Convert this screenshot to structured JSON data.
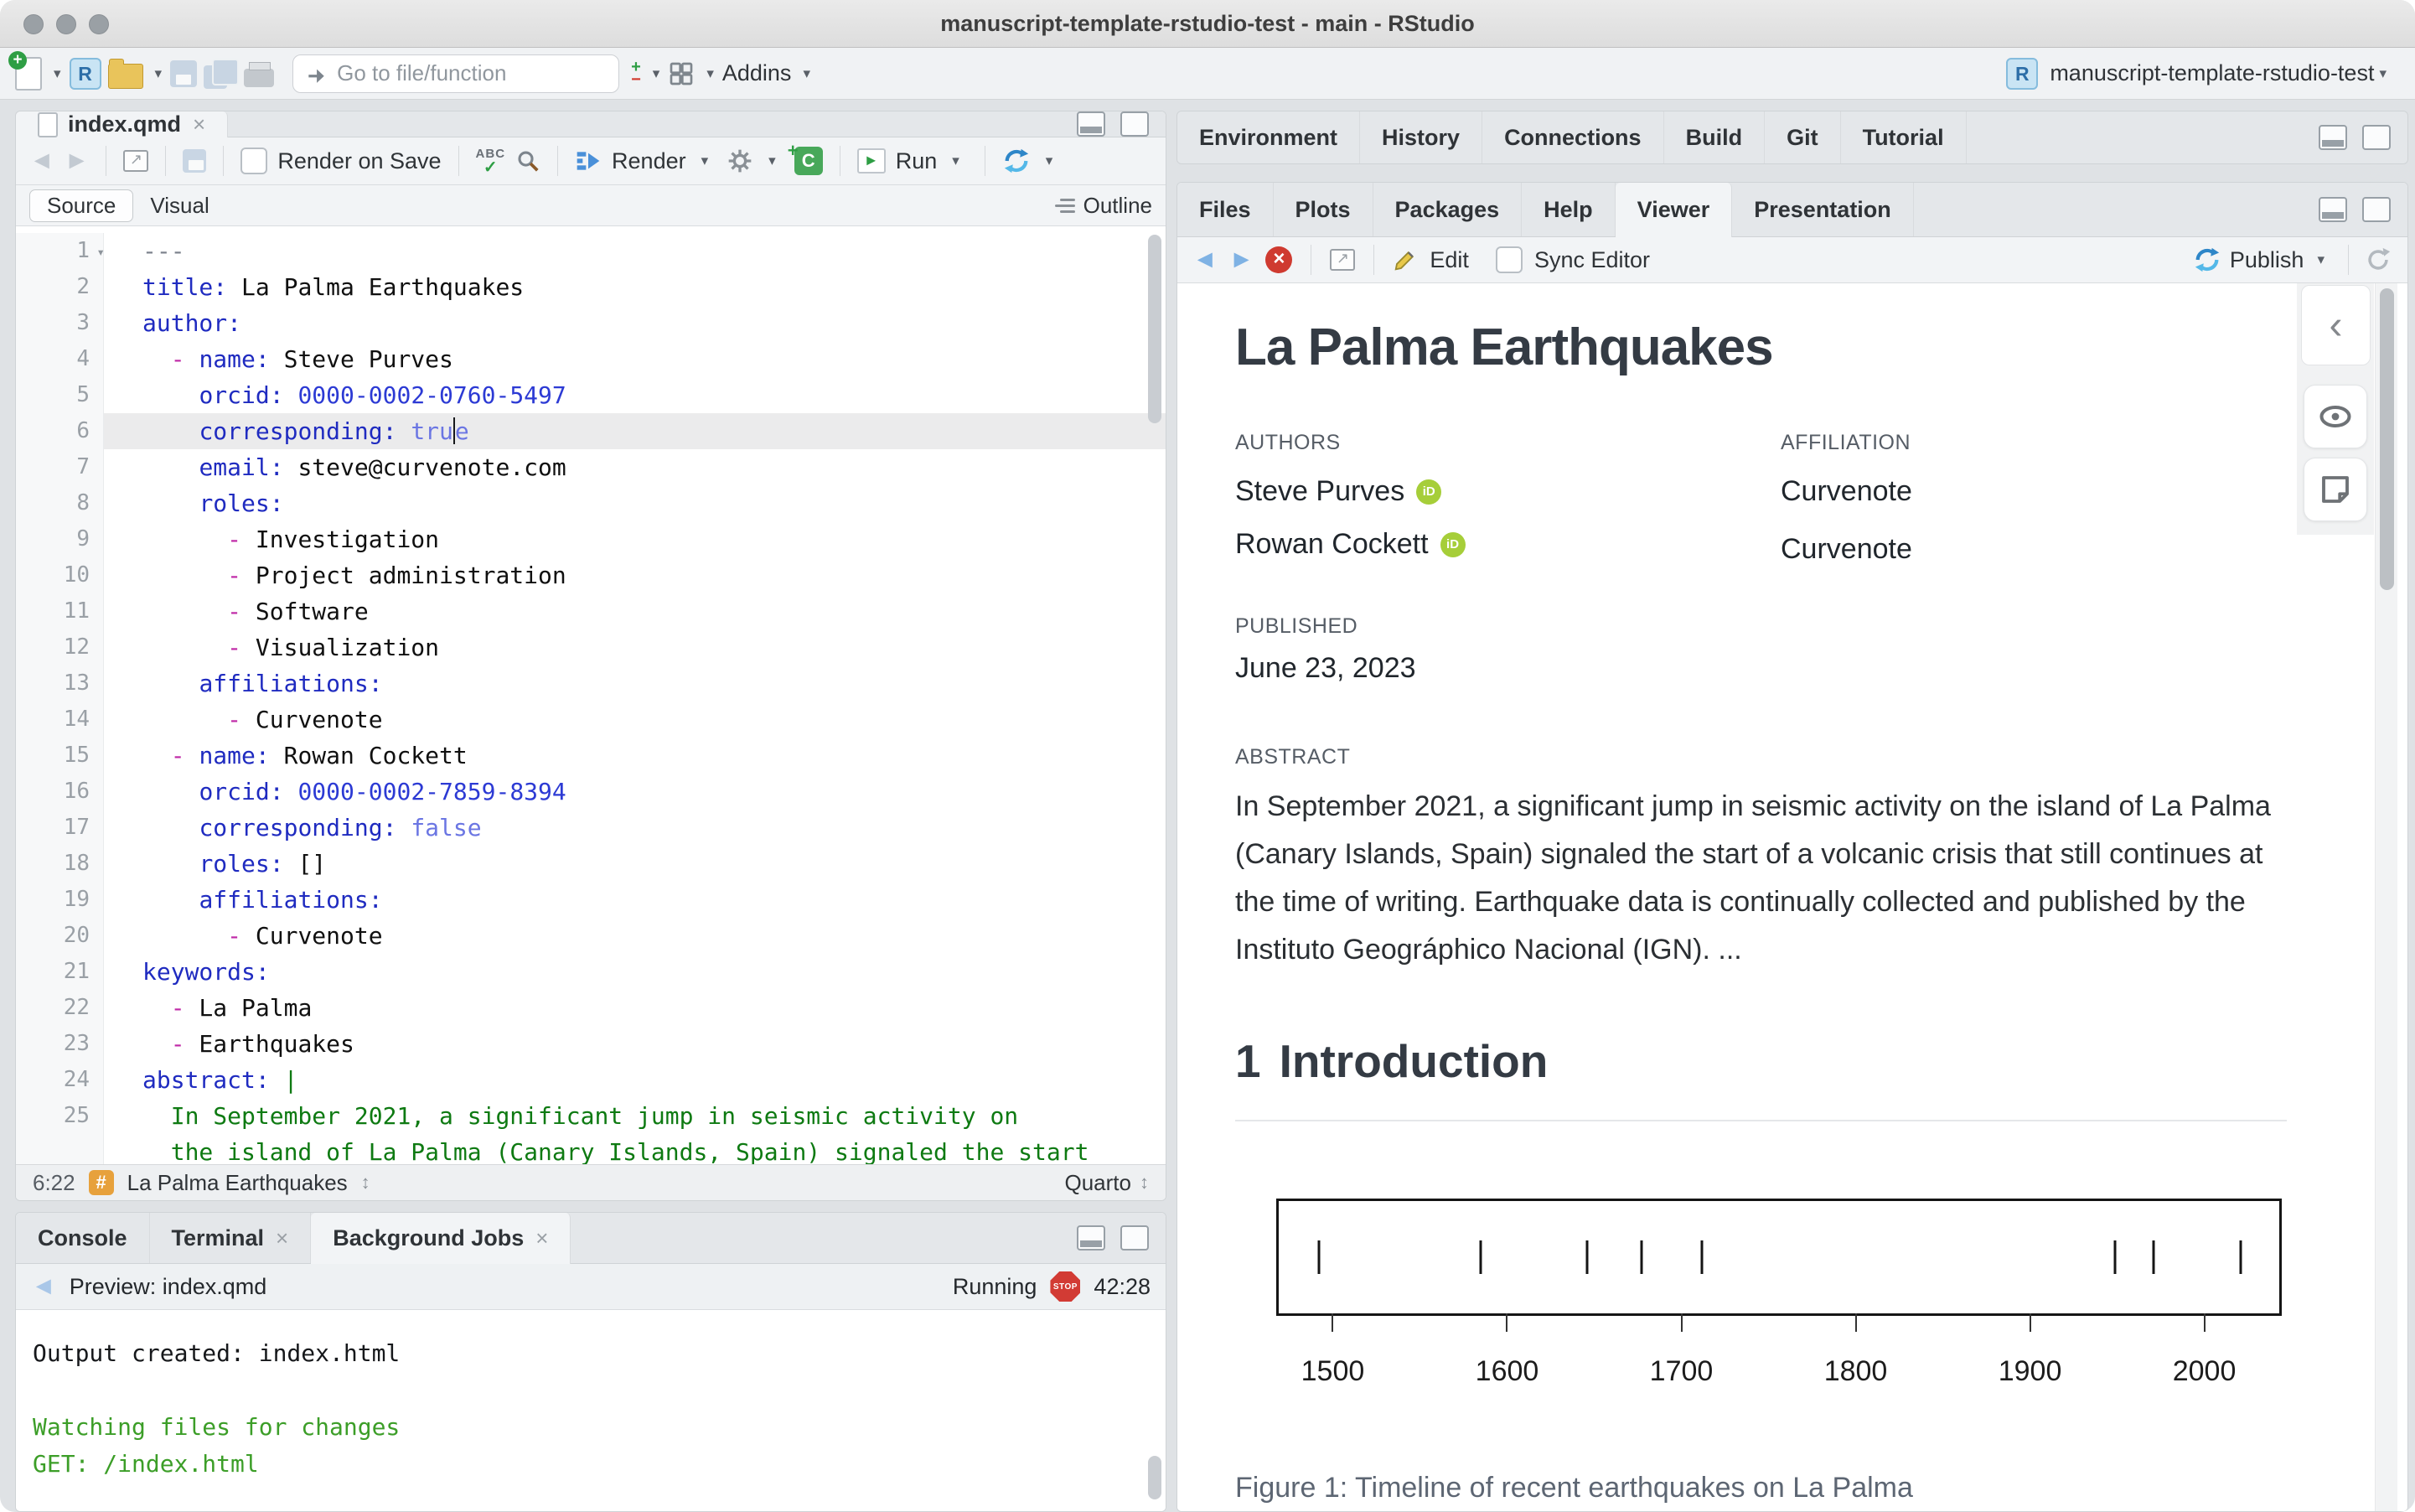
{
  "window": {
    "title": "manuscript-template-rstudio-test - main - RStudio"
  },
  "main_toolbar": {
    "goto_placeholder": "Go to file/function",
    "addins_label": "Addins",
    "project_name": "manuscript-template-rstudio-test"
  },
  "editor": {
    "tab_label": "index.qmd",
    "toolbar": {
      "render_on_save": "Render on Save",
      "render": "Render",
      "run": "Run"
    },
    "mode_tabs": {
      "source": "Source",
      "visual": "Visual",
      "outline": "Outline"
    },
    "status": {
      "position": "6:22",
      "section": "La Palma Earthquakes",
      "mode": "Quarto"
    },
    "lines": [
      {
        "n": "1",
        "fold": true,
        "tokens": [
          [
            "c",
            "---"
          ]
        ]
      },
      {
        "n": "2",
        "tokens": [
          [
            "k",
            "title:"
          ],
          [
            "p",
            " La Palma Earthquakes"
          ]
        ]
      },
      {
        "n": "3",
        "tokens": [
          [
            "k",
            "author:"
          ]
        ]
      },
      {
        "n": "4",
        "tokens": [
          [
            "p",
            "  "
          ],
          [
            "d",
            "-"
          ],
          [
            "p",
            " "
          ],
          [
            "k",
            "name:"
          ],
          [
            "p",
            " Steve Purves"
          ]
        ]
      },
      {
        "n": "5",
        "tokens": [
          [
            "p",
            "    "
          ],
          [
            "k",
            "orcid:"
          ],
          [
            "p",
            " "
          ],
          [
            "n",
            "0000-0002-0760-5497"
          ]
        ]
      },
      {
        "n": "6",
        "active": true,
        "tokens": [
          [
            "p",
            "    "
          ],
          [
            "k",
            "corresponding:"
          ],
          [
            "p",
            " "
          ],
          [
            "b",
            "tru"
          ],
          [
            "cur",
            ""
          ],
          [
            "b",
            "e"
          ]
        ]
      },
      {
        "n": "7",
        "tokens": [
          [
            "p",
            "    "
          ],
          [
            "k",
            "email:"
          ],
          [
            "p",
            " steve@curvenote.com"
          ]
        ]
      },
      {
        "n": "8",
        "tokens": [
          [
            "p",
            "    "
          ],
          [
            "k",
            "roles:"
          ]
        ]
      },
      {
        "n": "9",
        "tokens": [
          [
            "p",
            "      "
          ],
          [
            "d",
            "-"
          ],
          [
            "p",
            " Investigation"
          ]
        ]
      },
      {
        "n": "10",
        "tokens": [
          [
            "p",
            "      "
          ],
          [
            "d",
            "-"
          ],
          [
            "p",
            " Project administration"
          ]
        ]
      },
      {
        "n": "11",
        "tokens": [
          [
            "p",
            "      "
          ],
          [
            "d",
            "-"
          ],
          [
            "p",
            " Software"
          ]
        ]
      },
      {
        "n": "12",
        "tokens": [
          [
            "p",
            "      "
          ],
          [
            "d",
            "-"
          ],
          [
            "p",
            " Visualization"
          ]
        ]
      },
      {
        "n": "13",
        "tokens": [
          [
            "p",
            "    "
          ],
          [
            "k",
            "affiliations:"
          ]
        ]
      },
      {
        "n": "14",
        "tokens": [
          [
            "p",
            "      "
          ],
          [
            "d",
            "-"
          ],
          [
            "p",
            " Curvenote"
          ]
        ]
      },
      {
        "n": "15",
        "tokens": [
          [
            "p",
            "  "
          ],
          [
            "d",
            "-"
          ],
          [
            "p",
            " "
          ],
          [
            "k",
            "name:"
          ],
          [
            "p",
            " Rowan Cockett"
          ]
        ]
      },
      {
        "n": "16",
        "tokens": [
          [
            "p",
            "    "
          ],
          [
            "k",
            "orcid:"
          ],
          [
            "p",
            " "
          ],
          [
            "n",
            "0000-0002-7859-8394"
          ]
        ]
      },
      {
        "n": "17",
        "tokens": [
          [
            "p",
            "    "
          ],
          [
            "k",
            "corresponding:"
          ],
          [
            "p",
            " "
          ],
          [
            "b",
            "false"
          ]
        ]
      },
      {
        "n": "18",
        "tokens": [
          [
            "p",
            "    "
          ],
          [
            "k",
            "roles:"
          ],
          [
            "p",
            " []"
          ]
        ]
      },
      {
        "n": "19",
        "tokens": [
          [
            "p",
            "    "
          ],
          [
            "k",
            "affiliations:"
          ]
        ]
      },
      {
        "n": "20",
        "tokens": [
          [
            "p",
            "      "
          ],
          [
            "d",
            "-"
          ],
          [
            "p",
            " Curvenote"
          ]
        ]
      },
      {
        "n": "21",
        "tokens": [
          [
            "k",
            "keywords:"
          ]
        ]
      },
      {
        "n": "22",
        "tokens": [
          [
            "p",
            "  "
          ],
          [
            "d",
            "-"
          ],
          [
            "p",
            " La Palma"
          ]
        ]
      },
      {
        "n": "23",
        "tokens": [
          [
            "p",
            "  "
          ],
          [
            "d",
            "-"
          ],
          [
            "p",
            " Earthquakes"
          ]
        ]
      },
      {
        "n": "24",
        "tokens": [
          [
            "k",
            "abstract:"
          ],
          [
            "p",
            " "
          ],
          [
            "g",
            "|"
          ]
        ]
      },
      {
        "n": "25",
        "tokens": [
          [
            "p",
            "  "
          ],
          [
            "g",
            "In September 2021, a significant jump in seismic activity on"
          ]
        ]
      },
      {
        "n": "",
        "tokens": [
          [
            "p",
            "  "
          ],
          [
            "g",
            "the island of La Palma (Canary Islands, Spain) signaled the start"
          ]
        ]
      }
    ]
  },
  "console_pane": {
    "tabs": [
      "Console",
      "Terminal",
      "Background Jobs"
    ],
    "active_tab": "Background Jobs",
    "toolbar": {
      "preview": "Preview: index.qmd",
      "running": "Running",
      "stop": "STOP",
      "elapsed": "42:28"
    },
    "output": [
      {
        "text": "Output created: index.html",
        "color": "default"
      },
      {
        "text": "",
        "color": "default"
      },
      {
        "text": "Watching files for changes",
        "color": "green"
      },
      {
        "text": "GET: /index.html",
        "color": "green"
      }
    ]
  },
  "workspace_tabs": [
    "Environment",
    "History",
    "Connections",
    "Build",
    "Git",
    "Tutorial"
  ],
  "viewer_pane": {
    "tabs": [
      "Files",
      "Plots",
      "Packages",
      "Help",
      "Viewer",
      "Presentation"
    ],
    "active_tab": "Viewer",
    "toolbar": {
      "edit": "Edit",
      "sync_editor": "Sync Editor",
      "publish": "Publish"
    }
  },
  "article": {
    "title": "La Palma Earthquakes",
    "authors_label": "AUTHORS",
    "affiliation_label": "AFFILIATION",
    "authors": [
      {
        "name": "Steve Purves",
        "affiliation": "Curvenote"
      },
      {
        "name": "Rowan Cockett",
        "affiliation": "Curvenote"
      }
    ],
    "published_label": "PUBLISHED",
    "published_date": "June 23, 2023",
    "abstract_label": "ABSTRACT",
    "abstract_text": "In September 2021, a significant jump in seismic activity on the island of La Palma (Canary Islands, Spain) signaled the start of a volcanic crisis that still continues at the time of writing. Earthquake data is continually collected and published by the Instituto Geográphico Nacional (IGN). ...",
    "section_number": "1",
    "section_title": "Introduction",
    "figure_caption": "Figure 1: Timeline of recent earthquakes on La Palma"
  },
  "chart_data": {
    "type": "scatter",
    "style": "event-timeline-rug",
    "title": "",
    "xlabel": "",
    "ylabel": "",
    "events": [
      1492,
      1585,
      1646,
      1677,
      1712,
      1949,
      1971,
      2021
    ],
    "x_ticks": [
      1500,
      1600,
      1700,
      1800,
      1900,
      2000
    ],
    "xlim": [
      1469,
      2043
    ],
    "grid": false,
    "caption": "Figure 1: Timeline of recent earthquakes on La Palma"
  },
  "icons": {
    "dropdown_caret": "▾",
    "close": "×",
    "fold_caret": "▾",
    "updown": "↕",
    "back_arrow": "◄",
    "forward_arrow": "►",
    "popout_arrow": "↗",
    "check": "✓",
    "spell_abc": "ABC",
    "plus": "+",
    "minus": "−",
    "letter_r": "R",
    "letter_c": "C",
    "hash": "#",
    "orcid_id": "iD",
    "chevron_left": "‹"
  },
  "colors": {
    "yaml_key": "#1f2bc0",
    "yaml_number": "#2c3ad4",
    "yaml_bool": "#6b76e3",
    "yaml_dash": "#c02ba8",
    "yaml_string": "#0e7a12",
    "console_green": "#3c9e28",
    "orcid_green": "#a6ce39",
    "publish_blue": "#2e86c8",
    "stop_red": "#cf3a30",
    "hash_badge_orange": "#e7a13c",
    "render_blue": "#4a90d9"
  }
}
